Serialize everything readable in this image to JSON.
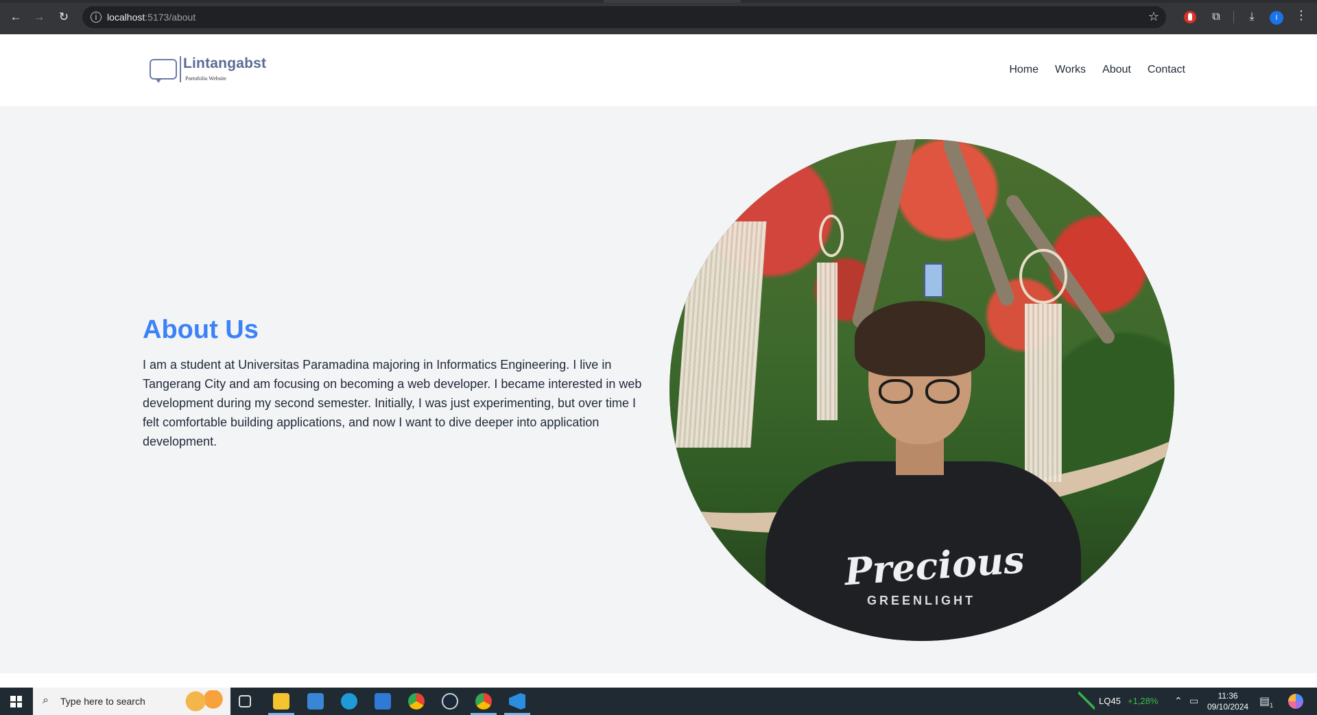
{
  "browser": {
    "url_host": "localhost",
    "url_path": ":5173/about",
    "nav": {
      "back": "←",
      "forward": "→",
      "reload": "↻"
    },
    "icons": [
      "info-icon",
      "star-icon",
      "extension-red-icon",
      "puzzle-icon",
      "download-icon",
      "profile-icon",
      "menu-kebab-icon"
    ],
    "profile_initial": "I"
  },
  "site": {
    "brand": "Lintangabst",
    "tagline": "Portofolio Website",
    "nav": [
      "Home",
      "Works",
      "About",
      "Contact"
    ],
    "accent_color": "#3b82f6",
    "logo_color": "#6b7aa8"
  },
  "about": {
    "title": "About Us",
    "body": "I am a student at Universitas Paramadina majoring in Informatics Engineering. I live in Tangerang City and am focusing on becoming a web developer. I became interested in web development during my second semester. Initially, I was just experimenting, but over time I felt comfortable building applications, and now I want to dive deeper into application development.",
    "photo": {
      "shirt_text": "Precious",
      "shirt_sub": "GREENLIGHT"
    }
  },
  "taskbar": {
    "search_placeholder": "Type here to search",
    "apps": [
      "task-view-icon",
      "file-explorer-icon",
      "microsoft-store-icon",
      "edge-icon",
      "mail-icon",
      "chrome-icon",
      "steam-icon",
      "chrome-profile-icon",
      "vscode-icon"
    ],
    "ticker_label": "LQ45",
    "ticker_value": "+1,28%",
    "time": "11:36",
    "date": "09/10/2024",
    "notification_count": "1"
  }
}
